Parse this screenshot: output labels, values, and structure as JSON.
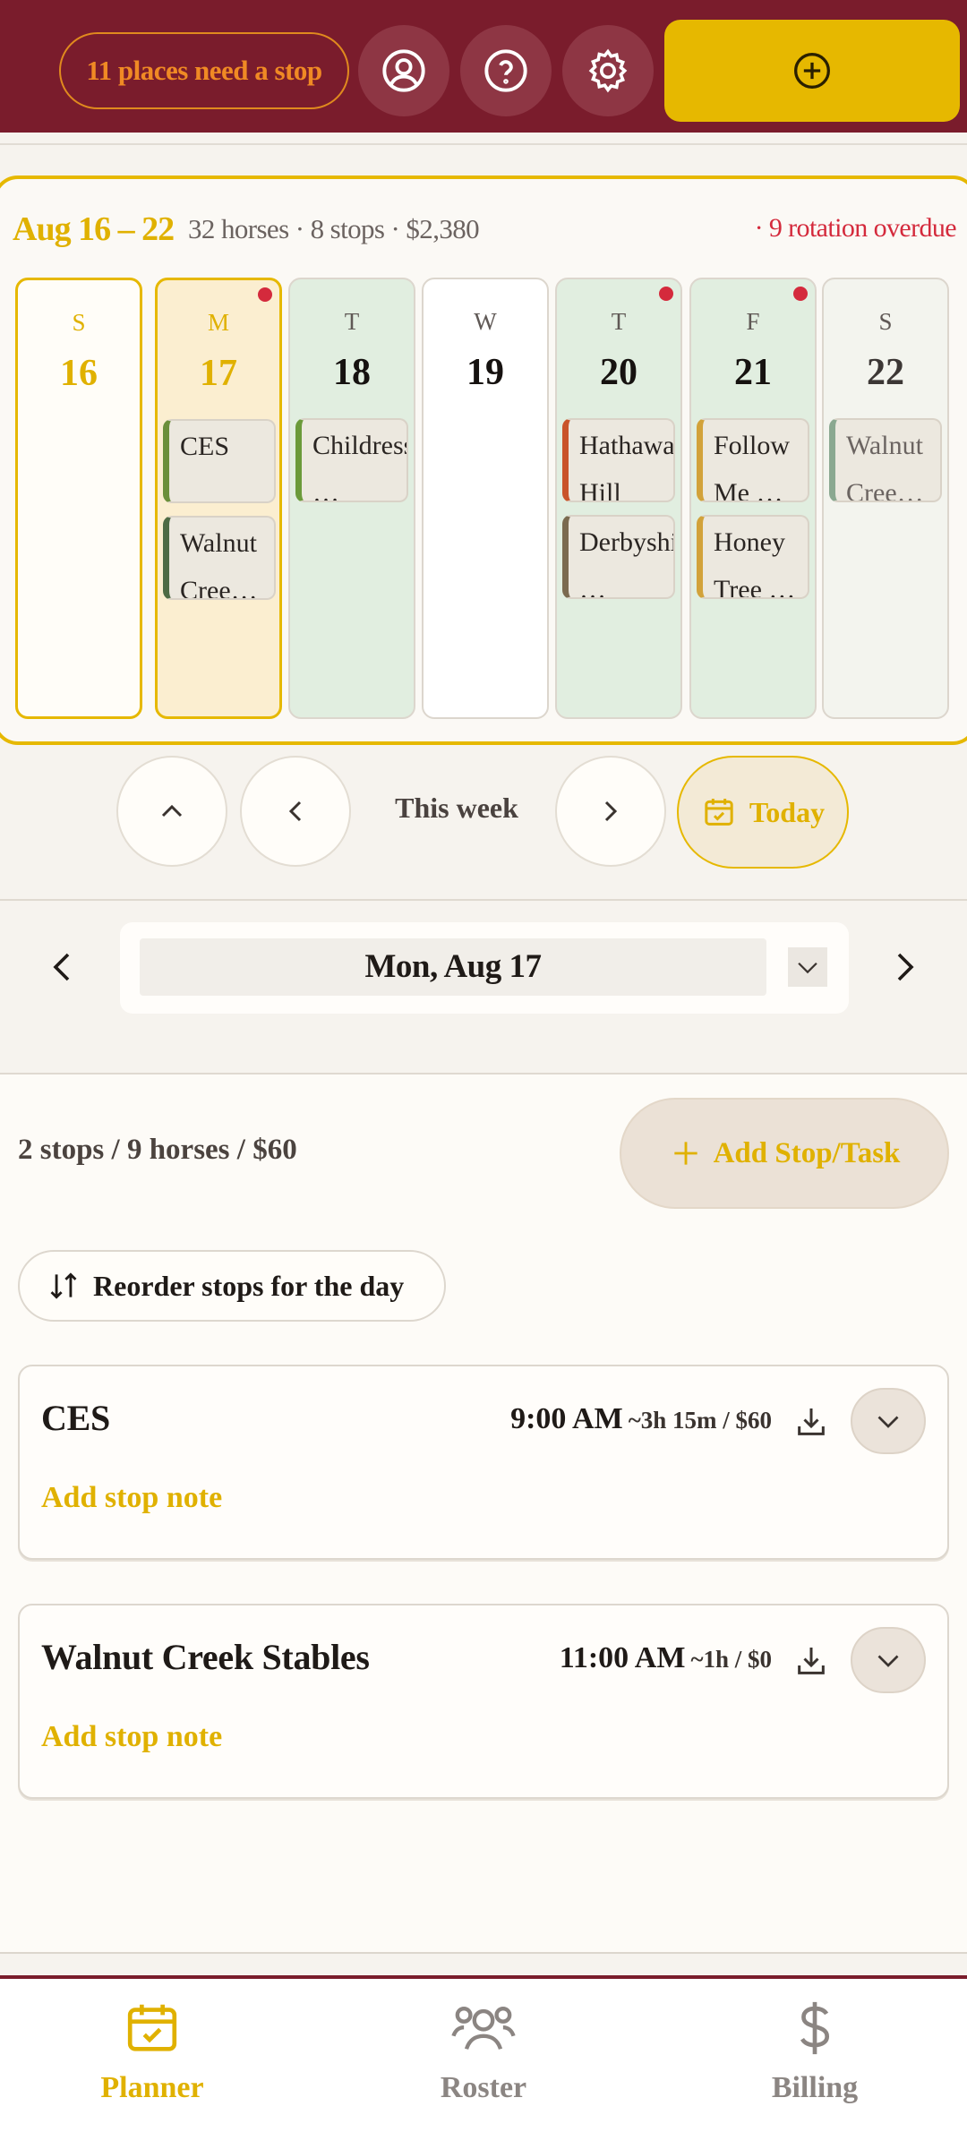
{
  "header": {
    "places_label": "11 places need a stop",
    "icons": [
      "user-circle-icon",
      "help-icon",
      "gear-icon",
      "plus-circle-icon"
    ]
  },
  "week": {
    "range": "Aug 16 – 22",
    "summary": "32 horses · 8 stops · $2,380",
    "overdue": "· 9 rotation overdue",
    "days": [
      {
        "dow": "S",
        "num": "16",
        "chips": []
      },
      {
        "dow": "M",
        "num": "17",
        "chips": [
          "CES",
          "Walnut Cree…"
        ]
      },
      {
        "dow": "T",
        "num": "18",
        "chips": [
          "Childress …"
        ]
      },
      {
        "dow": "W",
        "num": "19",
        "chips": []
      },
      {
        "dow": "T",
        "num": "20",
        "chips": [
          "Hathaway Hill",
          "Derbyshire …"
        ]
      },
      {
        "dow": "F",
        "num": "21",
        "chips": [
          "Follow Me …",
          "Honey Tree …"
        ]
      },
      {
        "dow": "S",
        "num": "22",
        "chips": [
          "Walnut Cree…"
        ]
      }
    ]
  },
  "week_nav": {
    "label": "This week",
    "today": "Today"
  },
  "day_picker": {
    "selected": "Mon, Aug 17"
  },
  "day": {
    "summary": "2 stops / 9 horses / $60",
    "add_label": "Add Stop/Task",
    "reorder_label": "Reorder stops for the day",
    "stops": [
      {
        "name": "CES",
        "time": "9:00 AM",
        "duration": "~3h 15m / $60",
        "note": "Add stop note"
      },
      {
        "name": "Walnut Creek Stables",
        "time": "11:00 AM",
        "duration": "~1h / $0",
        "note": "Add stop note"
      }
    ]
  },
  "nav": {
    "planner": "Planner",
    "roster": "Roster",
    "billing": "Billing"
  },
  "colors": {
    "brand": "#7a1c2c",
    "accent": "#e6b800",
    "alert": "#d42a3c"
  }
}
